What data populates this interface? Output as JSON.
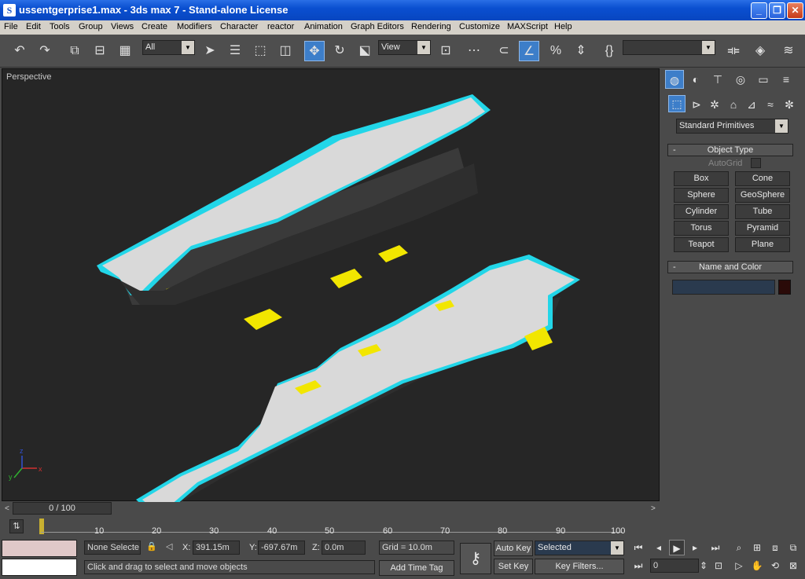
{
  "window": {
    "title": "ussentgerprise1.max - 3ds max 7 - Stand-alone License",
    "app_icon": "3ds-max-icon",
    "controls": {
      "minimize": "_",
      "maximize": "❐",
      "close": "✕"
    }
  },
  "menu": [
    "File",
    "Edit",
    "Tools",
    "Group",
    "Views",
    "Create",
    "Modifiers",
    "Character",
    "reactor",
    "Animation",
    "Graph Editors",
    "Rendering",
    "Customize",
    "MAXScript",
    "Help"
  ],
  "toolbar": {
    "selection_filter": "All",
    "ref_coord": "View",
    "named_selection": "",
    "icons": [
      "undo-icon",
      "redo-icon",
      "link-icon",
      "unlink-icon",
      "bind-spacewarp-icon",
      "select-object-icon",
      "select-by-name-icon",
      "rectangular-selection-icon",
      "window-crossing-icon",
      "select-move-icon",
      "select-rotate-icon",
      "select-scale-icon",
      "pivot-center-icon",
      "manipulate-icon",
      "snap-3d-icon",
      "angle-snap-icon",
      "percent-snap-icon",
      "spinner-snap-icon",
      "edit-named-selections-icon",
      "mirror-icon",
      "align-icon",
      "layer-manager-icon"
    ]
  },
  "viewport": {
    "label": "Perspective",
    "axis_labels": {
      "x": "x",
      "y": "y",
      "z": "z"
    }
  },
  "command_panel": {
    "tabs": [
      "create-tab",
      "modify-tab",
      "hierarchy-tab",
      "motion-tab",
      "display-tab",
      "utilities-tab"
    ],
    "categories": [
      "geometry-icon",
      "shapes-icon",
      "lights-icon",
      "cameras-icon",
      "helpers-icon",
      "space-warps-icon",
      "systems-icon"
    ],
    "dropdown": "Standard Primitives",
    "object_type": {
      "header": "Object Type",
      "autogrid": "AutoGrid",
      "buttons": [
        "Box",
        "Cone",
        "Sphere",
        "GeoSphere",
        "Cylinder",
        "Tube",
        "Torus",
        "Pyramid",
        "Teapot",
        "Plane"
      ]
    },
    "name_and_color": {
      "header": "Name and Color",
      "name_value": "",
      "color": "#2a0a08"
    }
  },
  "timeline": {
    "slider_label": "0 / 100",
    "ticks": [
      "10",
      "20",
      "30",
      "40",
      "50",
      "60",
      "70",
      "80",
      "90",
      "100"
    ]
  },
  "status": {
    "selection": "None Selecte",
    "x_label": "X:",
    "x_value": "391.15m",
    "y_label": "Y:",
    "y_value": "-697.67m",
    "z_label": "Z:",
    "z_value": "0.0m",
    "grid": "Grid = 10.0m",
    "prompt": "Click and drag to select and move objects",
    "add_time_tag": "Add Time Tag",
    "auto_key": "Auto Key",
    "set_key": "Set Key",
    "key_mode": "Selected",
    "key_filters": "Key Filters...",
    "frame": "0"
  },
  "colors": {
    "ship_deck": "#d9d9d9",
    "ship_outline": "#22d6e8",
    "elevator": "#f2e600",
    "hull": "#3a3a3a",
    "viewport_bg": "#262626",
    "accent_active": "#3d7ec9"
  }
}
